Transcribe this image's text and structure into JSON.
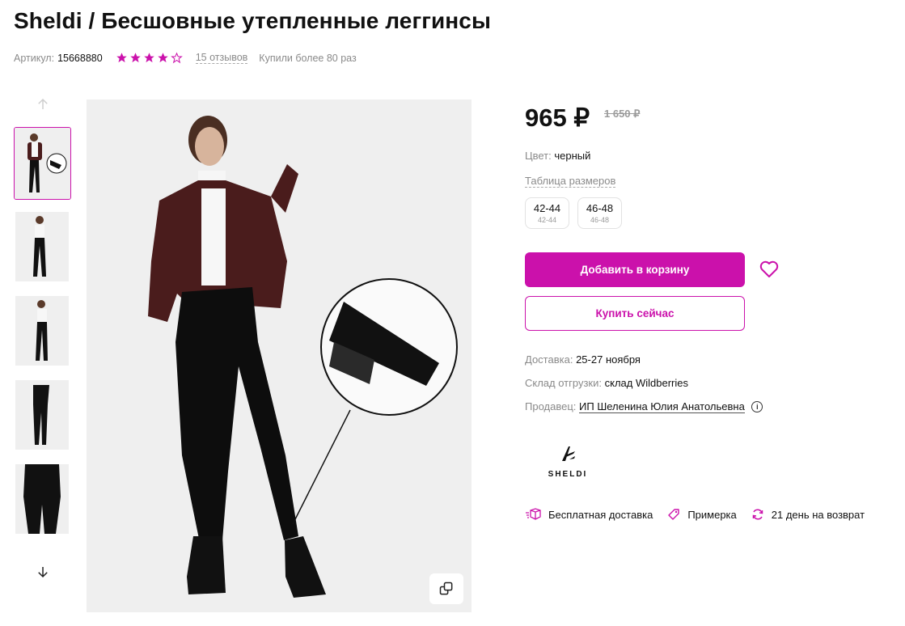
{
  "product": {
    "title": "Sheldi / Бесшовные утепленные леггинсы",
    "article_label": "Артикул:",
    "article_value": "15668880",
    "rating_stars": 4,
    "rating_max": 5,
    "reviews": "15 отзывов",
    "bought": "Купили более 80 раз"
  },
  "gallery": {
    "thumbnails": [
      "thumb-1",
      "thumb-2",
      "thumb-3",
      "thumb-4",
      "thumb-5"
    ],
    "active_index": 0,
    "zoom_icon": "copy-icon"
  },
  "pricing": {
    "price": "965 ₽",
    "old_price": "1 650 ₽"
  },
  "options": {
    "color_label": "Цвет:",
    "color_value": "черный",
    "size_table_link": "Таблица размеров",
    "sizes": [
      {
        "label": "42-44",
        "sub": "42-44"
      },
      {
        "label": "46-48",
        "sub": "46-48"
      }
    ]
  },
  "actions": {
    "add_to_cart": "Добавить в корзину",
    "buy_now": "Купить сейчас"
  },
  "delivery": {
    "delivery_label": "Доставка:",
    "delivery_value": "25-27 ноября",
    "warehouse_label": "Склад отгрузки:",
    "warehouse_value": "склад Wildberries",
    "seller_label": "Продавец:",
    "seller_value": "ИП Шеленина Юлия Анатольевна"
  },
  "brand": {
    "name": "SHELDI"
  },
  "perks": [
    {
      "label": "Бесплатная доставка",
      "icon": "box-icon"
    },
    {
      "label": "Примерка",
      "icon": "tag-icon"
    },
    {
      "label": "21 день на возврат",
      "icon": "refresh-icon"
    }
  ],
  "colors": {
    "accent": "#cb11ab",
    "muted": "#8a8a8a"
  }
}
